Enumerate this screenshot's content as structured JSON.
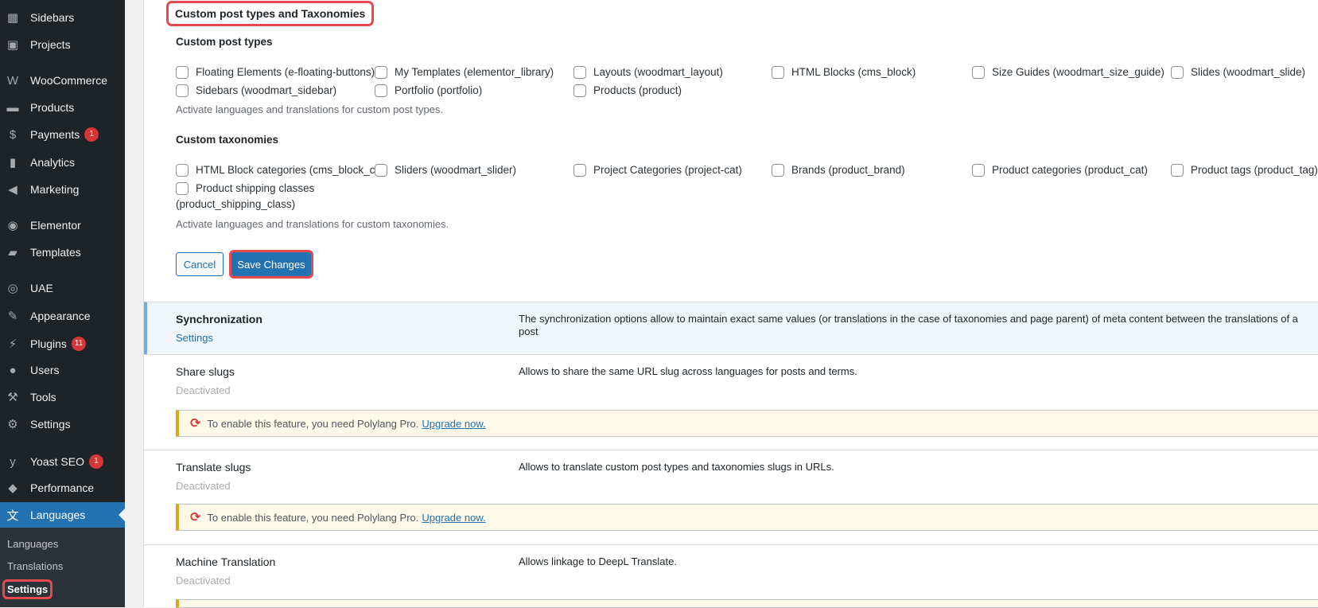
{
  "sidebar": {
    "items": [
      {
        "label": "Sidebars",
        "icon": "sidebars-icon",
        "glyph": "▦"
      },
      {
        "label": "Projects",
        "icon": "projects-icon",
        "glyph": "▣"
      },
      {
        "label": "WooCommerce",
        "icon": "woocommerce-icon",
        "glyph": "W"
      },
      {
        "label": "Products",
        "icon": "products-icon",
        "glyph": "▬"
      },
      {
        "label": "Payments",
        "icon": "payments-icon",
        "glyph": "$",
        "badge": "1"
      },
      {
        "label": "Analytics",
        "icon": "analytics-icon",
        "glyph": "▮"
      },
      {
        "label": "Marketing",
        "icon": "megaphone-icon",
        "glyph": "◀"
      },
      {
        "label": "Elementor",
        "icon": "elementor-icon",
        "glyph": "◉"
      },
      {
        "label": "Templates",
        "icon": "folder-icon",
        "glyph": "▰"
      },
      {
        "label": "UAE",
        "icon": "uae-icon",
        "glyph": "◎"
      },
      {
        "label": "Appearance",
        "icon": "brush-icon",
        "glyph": "✎"
      },
      {
        "label": "Plugins",
        "icon": "plug-icon",
        "glyph": "⚡",
        "badge": "11"
      },
      {
        "label": "Users",
        "icon": "user-icon",
        "glyph": "●"
      },
      {
        "label": "Tools",
        "icon": "wrench-icon",
        "glyph": "⚒"
      },
      {
        "label": "Settings",
        "icon": "settings-icon",
        "glyph": "⚙"
      },
      {
        "label": "Yoast SEO",
        "icon": "yoast-icon",
        "glyph": "y",
        "badge": "1"
      },
      {
        "label": "Performance",
        "icon": "performance-icon",
        "glyph": "◆"
      },
      {
        "label": "Languages",
        "icon": "translate-icon",
        "glyph": "文"
      }
    ],
    "submenu": [
      "Languages",
      "Translations",
      "Settings"
    ]
  },
  "section": {
    "title": "Custom post types and Taxonomies",
    "cpt_heading": "Custom post types",
    "cpt": [
      "Floating Elements (e-floating-buttons)",
      "My Templates (elementor_library)",
      "Layouts (woodmart_layout)",
      "HTML Blocks (cms_block)",
      "Size Guides (woodmart_size_guide)",
      "Slides (woodmart_slide)",
      "Sidebars (woodmart_sidebar)",
      "Portfolio (portfolio)",
      "Products (product)"
    ],
    "cpt_help": "Activate languages and translations for custom post types.",
    "tax_heading": "Custom taxonomies",
    "tax": [
      "HTML Block categories (cms_block_cat)",
      "Sliders (woodmart_slider)",
      "Project Categories (project-cat)",
      "Brands (product_brand)",
      "Product categories (product_cat)",
      "Product tags (product_tag)",
      "Product shipping classes",
      "(product_shipping_class)"
    ],
    "tax_help": "Activate languages and translations for custom taxonomies.",
    "cancel": "Cancel",
    "save": "Save Changes"
  },
  "modules": [
    {
      "title": "Synchronization",
      "status": "Settings",
      "desc": "The synchronization options allow to maintain exact same values (or translations in the case of taxonomies and page parent) of meta content between the translations of a post"
    },
    {
      "title": "Share slugs",
      "status": "Deactivated",
      "desc": "Allows to share the same URL slug across languages for posts and terms."
    },
    {
      "title": "Translate slugs",
      "status": "Deactivated",
      "desc": "Allows to translate custom post types and taxonomies slugs in URLs."
    },
    {
      "title": "Machine Translation",
      "status": "Deactivated",
      "desc": "Allows linkage to DeepL Translate."
    }
  ],
  "notice": {
    "text": "To enable this feature, you need Polylang Pro.",
    "link": "Upgrade now."
  }
}
